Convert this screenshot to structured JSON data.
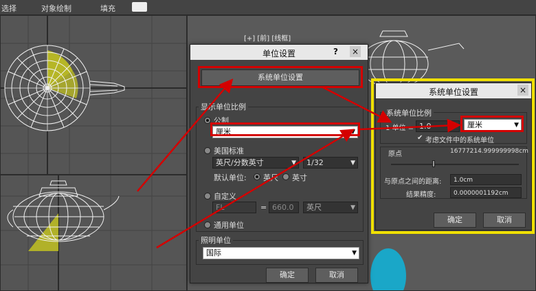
{
  "menubar": {
    "items": [
      "选择",
      "对象绘制",
      "填充"
    ]
  },
  "viewport": {
    "label": "[+] [前] [线框]"
  },
  "unit_dialog": {
    "title": "单位设置",
    "help": "?",
    "close": "×",
    "system_unit_button": "系统单位设置",
    "display_group": "显示单位比例",
    "metric_label": "公制",
    "metric_value": "厘米",
    "us_label": "美国标准",
    "us_value": "英尺/分数英寸",
    "us_fraction": "1/32",
    "default_unit_label": "默认单位:",
    "feet_label": "英尺",
    "inch_label": "英寸",
    "custom_label": "自定义",
    "custom_name": "FL",
    "equals": "=",
    "custom_value": "660.0",
    "custom_unit": "英尺",
    "generic_label": "通用单位",
    "lighting_group": "照明单位",
    "lighting_value": "国际",
    "ok": "确定",
    "cancel": "取消"
  },
  "system_dialog": {
    "title": "系统单位设置",
    "close": "×",
    "scale_group": "系统单位比例",
    "one_unit_label": "1 单位 =",
    "scale_value": "1.0",
    "unit_value": "厘米",
    "respect_label": "考虑文件中的系统单位",
    "origin_label": "原点",
    "origin_value": "16777214.999999998cm",
    "distance_label": "与原点之间的距离:",
    "distance_value": "1.0cm",
    "precision_label": "结果精度:",
    "precision_value": "0.0000001192cm",
    "ok": "确定",
    "cancel": "取消"
  }
}
